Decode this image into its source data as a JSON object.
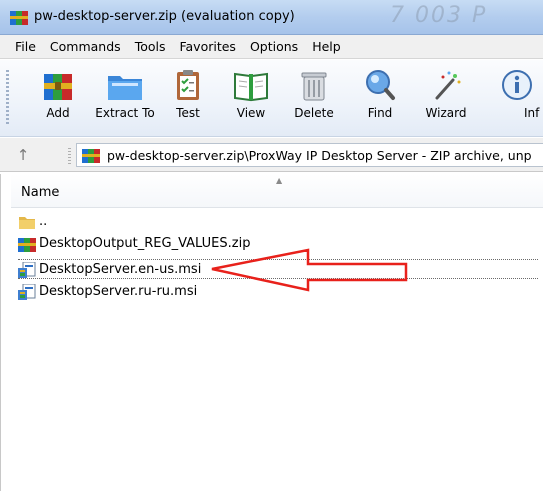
{
  "window": {
    "title": "pw-desktop-server.zip (evaluation copy)",
    "title_ghost": "7 003 P",
    "app_icon": "winrar-archive-icon"
  },
  "menu": {
    "items": [
      "File",
      "Commands",
      "Tools",
      "Favorites",
      "Options",
      "Help"
    ]
  },
  "toolbar": {
    "buttons": [
      {
        "label": "Add",
        "icon": "add-archive-icon"
      },
      {
        "label": "Extract To",
        "icon": "extract-folder-icon"
      },
      {
        "label": "Test",
        "icon": "test-clipboard-icon"
      },
      {
        "label": "View",
        "icon": "view-book-icon"
      },
      {
        "label": "Delete",
        "icon": "trash-can-icon"
      },
      {
        "label": "Find",
        "icon": "magnifier-icon"
      },
      {
        "label": "Wizard",
        "icon": "magic-wand-icon"
      },
      {
        "label": "Inf",
        "icon": "info-icon"
      }
    ]
  },
  "address": {
    "path": "pw-desktop-server.zip\\ProxWay IP Desktop Server - ZIP archive, unp",
    "up_icon": "up-arrow-icon"
  },
  "filelist": {
    "column_name": "Name",
    "rows": [
      {
        "name": "..",
        "icon": "folder-icon"
      },
      {
        "name": "DesktopOutput_REG_VALUES.zip",
        "icon": "winrar-archive-icon"
      },
      {
        "name": "DesktopServer.en-us.msi",
        "icon": "msi-installer-icon",
        "selected": true
      },
      {
        "name": "DesktopServer.ru-ru.msi",
        "icon": "msi-installer-icon"
      }
    ]
  },
  "annotation": {
    "color": "#e8211b",
    "points_to": "DesktopServer.en-us.msi"
  },
  "colors": {
    "titlebar": "#b3cdee",
    "toolbar": "#eef3fa",
    "menubar": "#f0f0f0"
  }
}
